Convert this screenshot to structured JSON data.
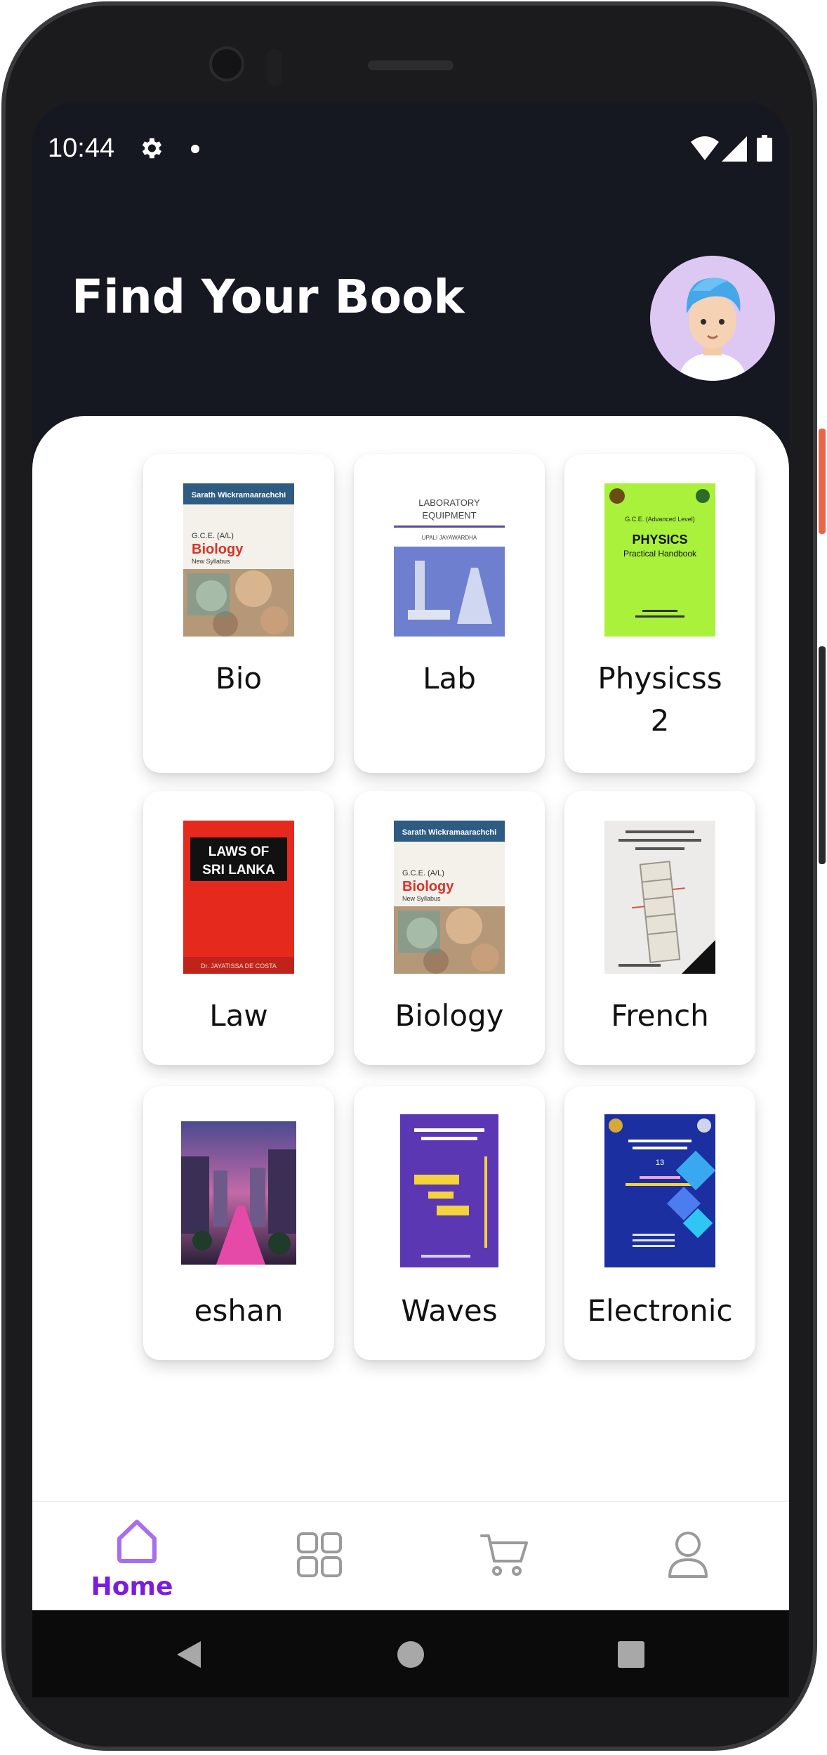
{
  "status_bar": {
    "time": "10:44"
  },
  "header": {
    "title": "Find Your Book"
  },
  "books": [
    {
      "title": "Bio",
      "cover": "biology-book-cover-icon",
      "cover_text": [
        "Sarath Wickramaarachchi",
        "G.C.E. (A/L)",
        "Biology",
        "New Syllabus"
      ]
    },
    {
      "title": "Lab",
      "cover": "lab-equipment-book-cover-icon",
      "cover_text": [
        "LABORATORY",
        "EQUIPMENT",
        "UPALI JAYAWARDHA"
      ]
    },
    {
      "title": "Physicss 2",
      "cover": "physics-handbook-cover-icon",
      "cover_text": [
        "G.C.E. (Advanced Level)",
        "PHYSICS",
        "Practical Handbook"
      ]
    },
    {
      "title": "Law",
      "cover": "laws-of-sri-lanka-cover-icon",
      "cover_text": [
        "LAWS OF",
        "SRI LANKA",
        "Dr. JAYATISSA DE COSTA"
      ]
    },
    {
      "title": "Biology",
      "cover": "biology-book-cover-icon",
      "cover_text": [
        "Sarath Wickramaarachchi",
        "G.C.E. (A/L)",
        "Biology",
        "New Syllabus"
      ]
    },
    {
      "title": "French",
      "cover": "leaning-tower-book-cover-icon",
      "cover_text": []
    },
    {
      "title": "eshan",
      "cover": "city-street-photo-icon",
      "cover_text": []
    },
    {
      "title": "Waves",
      "cover": "waves-book-cover-icon",
      "cover_text": []
    },
    {
      "title": "Electronic",
      "cover": "electronics-book-cover-icon",
      "cover_text": [
        "13"
      ]
    }
  ],
  "bottom_nav": {
    "items": [
      {
        "label": "Home",
        "icon": "home-icon",
        "active": true
      },
      {
        "label": "",
        "icon": "grid-icon",
        "active": false
      },
      {
        "label": "",
        "icon": "cart-icon",
        "active": false
      },
      {
        "label": "",
        "icon": "user-icon",
        "active": false
      }
    ]
  },
  "colors": {
    "header_bg": "#151820",
    "accent": "#7a1de0",
    "accent_light": "#a76ef0",
    "nav_inactive": "#9a9a9a"
  }
}
